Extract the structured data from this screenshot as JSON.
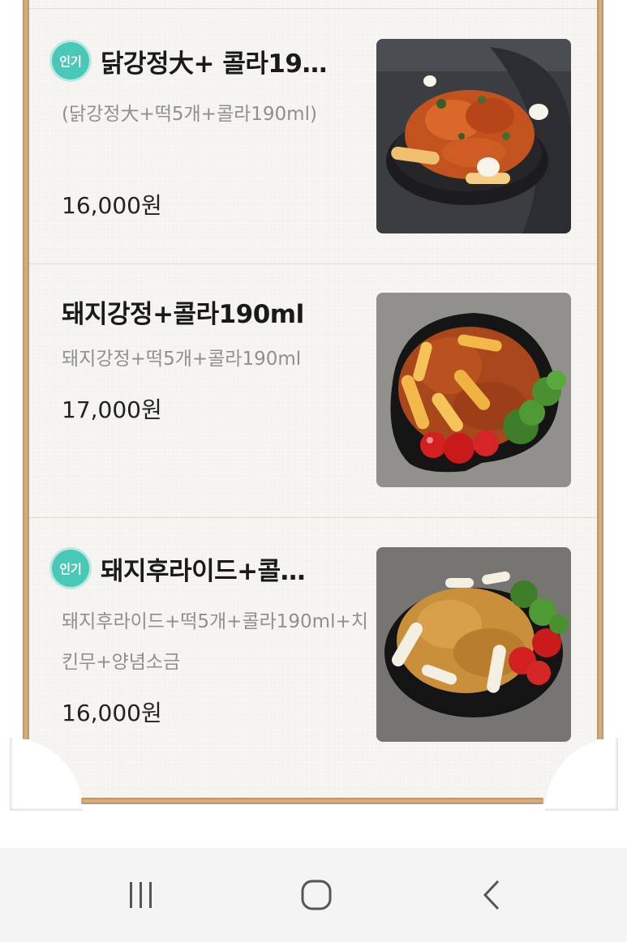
{
  "menu": {
    "items": [
      {
        "badge": "인기",
        "title": "닭강정大+ 콜라19…",
        "description": "(닭강정大+떡5개+콜라190ml)",
        "price": "16,000원",
        "image": "dakgangjeong-photo"
      },
      {
        "badge": "",
        "title": "돼지강정+콜라190ml",
        "description": "돼지강정+떡5개+콜라190ml",
        "price": "17,000원",
        "image": "pork-gangjeong-photo"
      },
      {
        "badge": "인기",
        "title": "돼지후라이드+콜…",
        "description": "돼지후라이드+떡5개+콜라190ml+치킨무+양념소금",
        "price": "16,000원",
        "image": "pork-fried-photo"
      }
    ]
  },
  "navbar": {
    "recent_apps": "recent-apps-icon",
    "home": "home-icon",
    "back": "back-icon"
  },
  "colors": {
    "badge": "#49c7b7",
    "frame": "#c9a276",
    "paper": "#f6f5f1"
  }
}
